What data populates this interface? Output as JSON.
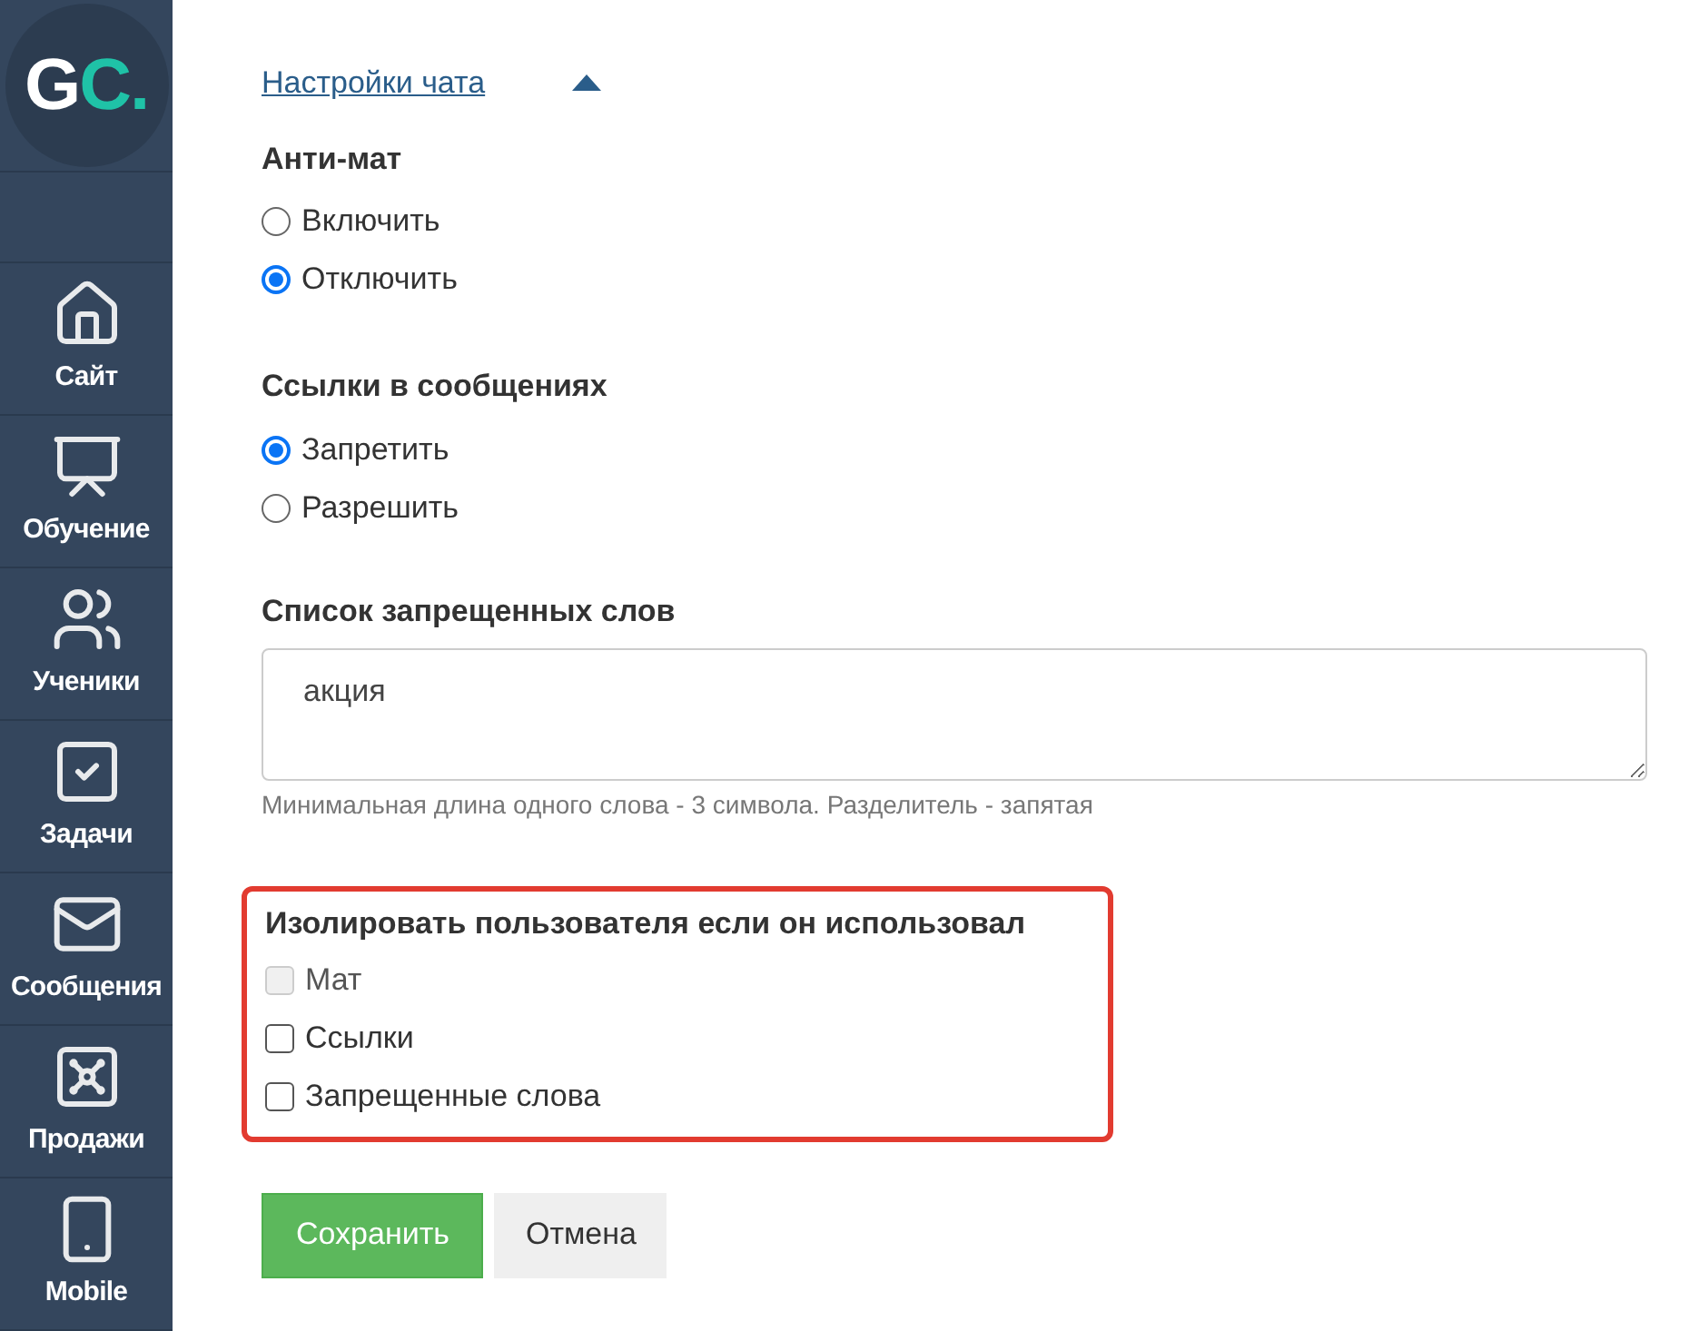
{
  "logo": {
    "main": "G",
    "accent": "C."
  },
  "sidebar": {
    "items": [
      {
        "kind": "home",
        "label": "Сайт"
      },
      {
        "kind": "training",
        "label": "Обучение"
      },
      {
        "kind": "users",
        "label": "Ученики"
      },
      {
        "kind": "tasks",
        "label": "Задачи"
      },
      {
        "kind": "mail",
        "label": "Сообщения"
      },
      {
        "kind": "sales",
        "label": "Продажи"
      },
      {
        "kind": "mobile",
        "label": "Mobile"
      }
    ]
  },
  "section_toggle": {
    "label": "Настройки чата",
    "expanded": true
  },
  "radio_groups": [
    {
      "title": "Анти-мат",
      "options": [
        {
          "label": "Включить",
          "selected": false
        },
        {
          "label": "Отключить",
          "selected": true
        }
      ]
    },
    {
      "title": "Ссылки в сообщениях",
      "options": [
        {
          "label": "Запретить",
          "selected": true
        },
        {
          "label": "Разрешить",
          "selected": false
        }
      ]
    }
  ],
  "banned_words": {
    "title": "Список запрещенных слов",
    "value": "акция",
    "hint": "Минимальная длина одного слова - 3 символа. Разделитель - запятая"
  },
  "isolate": {
    "title": "Изолировать пользователя если он использовал",
    "highlighted": true,
    "options": [
      {
        "label": "Мат",
        "checked": false,
        "disabled": true
      },
      {
        "label": "Ссылки",
        "checked": false,
        "disabled": false
      },
      {
        "label": "Запрещенные слова",
        "checked": false,
        "disabled": false
      }
    ]
  },
  "buttons": [
    {
      "kind": "primary",
      "label": "Сохранить"
    },
    {
      "kind": "secondary",
      "label": "Отмена"
    }
  ]
}
